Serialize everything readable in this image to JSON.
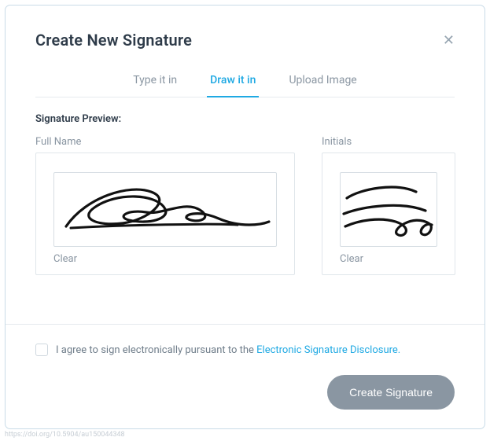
{
  "header": {
    "title": "Create New Signature"
  },
  "tabs": {
    "type": "Type it in",
    "draw": "Draw it in",
    "upload": "Upload Image"
  },
  "preview": {
    "label": "Signature Preview:",
    "fullName": {
      "label": "Full Name",
      "clear": "Clear"
    },
    "initials": {
      "label": "Initials",
      "clear": "Clear"
    }
  },
  "agree": {
    "text": "I agree to sign electronically pursuant to the ",
    "link": "Electronic Signature Disclosure."
  },
  "actions": {
    "create": "Create Signature"
  },
  "footnote": "https://doi.org/10.5904/au150044348"
}
